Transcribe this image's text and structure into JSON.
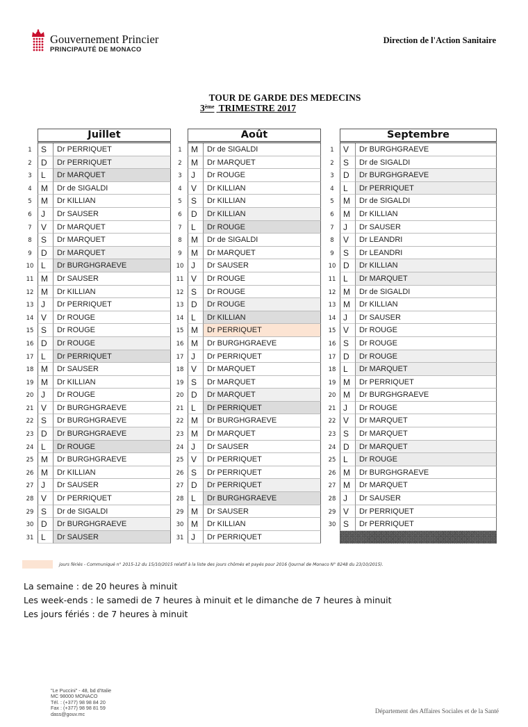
{
  "header": {
    "logo_title": "Gouvernement Princier",
    "logo_subtitle": "PRINCIPAUTÉ DE MONACO",
    "department": "Direction de l'Action Sanitaire",
    "brand_color": "#c8102e"
  },
  "title": {
    "line1": "TOUR DE GARDE DES MEDECINS",
    "line2_ordinal": "3",
    "line2_suffix": "ème",
    "line2_rest": "TRIMESTRE 2017"
  },
  "months": [
    {
      "name": "Juillet",
      "days": [
        {
          "n": "1",
          "dow": "S",
          "doctor": "Dr PERRIQUET",
          "shade": ""
        },
        {
          "n": "2",
          "dow": "D",
          "doctor": "Dr PERRIQUET",
          "shade": "sun"
        },
        {
          "n": "3",
          "dow": "L",
          "doctor": "Dr MARQUET",
          "shade": "mon"
        },
        {
          "n": "4",
          "dow": "M",
          "doctor": "Dr de SIGALDI",
          "shade": ""
        },
        {
          "n": "5",
          "dow": "M",
          "doctor": "Dr KILLIAN",
          "shade": ""
        },
        {
          "n": "6",
          "dow": "J",
          "doctor": "Dr SAUSER",
          "shade": ""
        },
        {
          "n": "7",
          "dow": "V",
          "doctor": "Dr MARQUET",
          "shade": ""
        },
        {
          "n": "8",
          "dow": "S",
          "doctor": "Dr MARQUET",
          "shade": ""
        },
        {
          "n": "9",
          "dow": "D",
          "doctor": "Dr MARQUET",
          "shade": "sun"
        },
        {
          "n": "10",
          "dow": "L",
          "doctor": "Dr BURGHGRAEVE",
          "shade": "mon"
        },
        {
          "n": "11",
          "dow": "M",
          "doctor": "Dr  SAUSER",
          "shade": ""
        },
        {
          "n": "12",
          "dow": "M",
          "doctor": "Dr KILLIAN",
          "shade": ""
        },
        {
          "n": "13",
          "dow": "J",
          "doctor": "Dr PERRIQUET",
          "shade": ""
        },
        {
          "n": "14",
          "dow": "V",
          "doctor": "Dr ROUGE",
          "shade": ""
        },
        {
          "n": "15",
          "dow": "S",
          "doctor": "Dr ROUGE",
          "shade": ""
        },
        {
          "n": "16",
          "dow": "D",
          "doctor": "Dr ROUGE",
          "shade": "sun"
        },
        {
          "n": "17",
          "dow": "L",
          "doctor": "Dr PERRIQUET",
          "shade": "mon"
        },
        {
          "n": "18",
          "dow": "M",
          "doctor": "Dr SAUSER",
          "shade": ""
        },
        {
          "n": "19",
          "dow": "M",
          "doctor": "Dr KILLIAN",
          "shade": ""
        },
        {
          "n": "20",
          "dow": "J",
          "doctor": "Dr ROUGE",
          "shade": ""
        },
        {
          "n": "21",
          "dow": "V",
          "doctor": "Dr BURGHGRAEVE",
          "shade": ""
        },
        {
          "n": "22",
          "dow": "S",
          "doctor": "Dr BURGHGRAEVE",
          "shade": ""
        },
        {
          "n": "23",
          "dow": "D",
          "doctor": "Dr BURGHGRAEVE",
          "shade": "sun"
        },
        {
          "n": "24",
          "dow": "L",
          "doctor": "Dr ROUGE",
          "shade": "mon"
        },
        {
          "n": "25",
          "dow": "M",
          "doctor": "Dr BURGHGRAEVE",
          "shade": ""
        },
        {
          "n": "26",
          "dow": "M",
          "doctor": "Dr KILLIAN",
          "shade": ""
        },
        {
          "n": "27",
          "dow": "J",
          "doctor": "Dr SAUSER",
          "shade": ""
        },
        {
          "n": "28",
          "dow": "V",
          "doctor": "Dr PERRIQUET",
          "shade": ""
        },
        {
          "n": "29",
          "dow": "S",
          "doctor": "Dr de SIGALDI",
          "shade": ""
        },
        {
          "n": "30",
          "dow": "D",
          "doctor": "Dr BURGHGRAEVE",
          "shade": "sun"
        },
        {
          "n": "31",
          "dow": "L",
          "doctor": "Dr SAUSER",
          "shade": "mon"
        }
      ]
    },
    {
      "name": "Août",
      "days": [
        {
          "n": "1",
          "dow": "M",
          "doctor": "Dr de SIGALDI",
          "shade": ""
        },
        {
          "n": "2",
          "dow": "M",
          "doctor": "Dr MARQUET",
          "shade": ""
        },
        {
          "n": "3",
          "dow": "J",
          "doctor": "Dr ROUGE",
          "shade": ""
        },
        {
          "n": "4",
          "dow": "V",
          "doctor": "Dr KILLIAN",
          "shade": ""
        },
        {
          "n": "5",
          "dow": "S",
          "doctor": "Dr KILLIAN",
          "shade": ""
        },
        {
          "n": "6",
          "dow": "D",
          "doctor": "Dr KILLIAN",
          "shade": "sun"
        },
        {
          "n": "7",
          "dow": "L",
          "doctor": "Dr ROUGE",
          "shade": "mon"
        },
        {
          "n": "8",
          "dow": "M",
          "doctor": "Dr de SIGALDI",
          "shade": ""
        },
        {
          "n": "9",
          "dow": "M",
          "doctor": "Dr MARQUET",
          "shade": ""
        },
        {
          "n": "10",
          "dow": "J",
          "doctor": "Dr SAUSER",
          "shade": ""
        },
        {
          "n": "11",
          "dow": "V",
          "doctor": "Dr ROUGE",
          "shade": ""
        },
        {
          "n": "12",
          "dow": "S",
          "doctor": "Dr ROUGE",
          "shade": ""
        },
        {
          "n": "13",
          "dow": "D",
          "doctor": "Dr ROUGE",
          "shade": "sun"
        },
        {
          "n": "14",
          "dow": "L",
          "doctor": "Dr KILLIAN",
          "shade": "mon"
        },
        {
          "n": "15",
          "dow": "M",
          "doctor": "Dr PERRIQUET",
          "shade": "holiday"
        },
        {
          "n": "16",
          "dow": "M",
          "doctor": "Dr BURGHGRAEVE",
          "shade": ""
        },
        {
          "n": "17",
          "dow": "J",
          "doctor": "Dr PERRIQUET",
          "shade": ""
        },
        {
          "n": "18",
          "dow": "V",
          "doctor": "Dr MARQUET",
          "shade": ""
        },
        {
          "n": "19",
          "dow": "S",
          "doctor": "Dr MARQUET",
          "shade": ""
        },
        {
          "n": "20",
          "dow": "D",
          "doctor": "Dr MARQUET",
          "shade": "sun"
        },
        {
          "n": "21",
          "dow": "L",
          "doctor": "Dr PERRIQUET",
          "shade": "mon"
        },
        {
          "n": "22",
          "dow": "M",
          "doctor": "Dr BURGHGRAEVE",
          "shade": ""
        },
        {
          "n": "23",
          "dow": "M",
          "doctor": "Dr MARQUET",
          "shade": ""
        },
        {
          "n": "24",
          "dow": "J",
          "doctor": "Dr SAUSER",
          "shade": ""
        },
        {
          "n": "25",
          "dow": "V",
          "doctor": "Dr PERRIQUET",
          "shade": ""
        },
        {
          "n": "26",
          "dow": "S",
          "doctor": "Dr PERRIQUET",
          "shade": ""
        },
        {
          "n": "27",
          "dow": "D",
          "doctor": "Dr PERRIQUET",
          "shade": "sun"
        },
        {
          "n": "28",
          "dow": "L",
          "doctor": "Dr BURGHGRAEVE",
          "shade": "mon"
        },
        {
          "n": "29",
          "dow": "M",
          "doctor": "Dr SAUSER",
          "shade": ""
        },
        {
          "n": "30",
          "dow": "M",
          "doctor": "Dr KILLIAN",
          "shade": ""
        },
        {
          "n": "31",
          "dow": "J",
          "doctor": " Dr PERRIQUET",
          "shade": ""
        }
      ]
    },
    {
      "name": "Septembre",
      "days": [
        {
          "n": "1",
          "dow": "V",
          "doctor": "Dr BURGHGRAEVE",
          "shade": ""
        },
        {
          "n": "2",
          "dow": "S",
          "doctor": "Dr de SIGALDI",
          "shade": ""
        },
        {
          "n": "3",
          "dow": "D",
          "doctor": "Dr BURGHGRAEVE",
          "shade": "sun"
        },
        {
          "n": "4",
          "dow": "L",
          "doctor": "Dr PERRIQUET",
          "shade": "mon-light"
        },
        {
          "n": "5",
          "dow": "M",
          "doctor": "Dr de SIGALDI",
          "shade": ""
        },
        {
          "n": "6",
          "dow": "M",
          "doctor": "Dr KILLIAN",
          "shade": ""
        },
        {
          "n": "7",
          "dow": "J",
          "doctor": "Dr SAUSER",
          "shade": ""
        },
        {
          "n": "8",
          "dow": "V",
          "doctor": "Dr LEANDRI",
          "shade": ""
        },
        {
          "n": "9",
          "dow": "S",
          "doctor": "Dr LEANDRI",
          "shade": ""
        },
        {
          "n": "10",
          "dow": "D",
          "doctor": "Dr KILLIAN",
          "shade": "sun"
        },
        {
          "n": "11",
          "dow": "L",
          "doctor": "Dr MARQUET",
          "shade": "mon-light"
        },
        {
          "n": "12",
          "dow": "M",
          "doctor": "Dr de SIGALDI",
          "shade": ""
        },
        {
          "n": "13",
          "dow": "M",
          "doctor": "Dr KILLIAN",
          "shade": ""
        },
        {
          "n": "14",
          "dow": "J",
          "doctor": "Dr SAUSER",
          "shade": ""
        },
        {
          "n": "15",
          "dow": "V",
          "doctor": "Dr ROUGE",
          "shade": ""
        },
        {
          "n": "16",
          "dow": "S",
          "doctor": "Dr ROUGE",
          "shade": ""
        },
        {
          "n": "17",
          "dow": "D",
          "doctor": "Dr ROUGE",
          "shade": "sun"
        },
        {
          "n": "18",
          "dow": "L",
          "doctor": "Dr MARQUET",
          "shade": "mon-light"
        },
        {
          "n": "19",
          "dow": "M",
          "doctor": "Dr PERRIQUET",
          "shade": ""
        },
        {
          "n": "20",
          "dow": "M",
          "doctor": "Dr BURGHGRAEVE",
          "shade": ""
        },
        {
          "n": "21",
          "dow": "J",
          "doctor": "Dr ROUGE",
          "shade": ""
        },
        {
          "n": "22",
          "dow": "V",
          "doctor": "Dr MARQUET",
          "shade": ""
        },
        {
          "n": "23",
          "dow": "S",
          "doctor": "Dr MARQUET",
          "shade": ""
        },
        {
          "n": "24",
          "dow": "D",
          "doctor": "Dr MARQUET",
          "shade": "sun"
        },
        {
          "n": "25",
          "dow": "L",
          "doctor": "Dr ROUGE",
          "shade": "mon-light"
        },
        {
          "n": "26",
          "dow": "M",
          "doctor": "Dr BURGHGRAEVE",
          "shade": ""
        },
        {
          "n": "27",
          "dow": "M",
          "doctor": "Dr MARQUET",
          "shade": ""
        },
        {
          "n": "28",
          "dow": "J",
          "doctor": "Dr SAUSER",
          "shade": ""
        },
        {
          "n": "29",
          "dow": "V",
          "doctor": "Dr PERRIQUET",
          "shade": ""
        },
        {
          "n": "30",
          "dow": "S",
          "doctor": "Dr PERRIQUET",
          "shade": ""
        }
      ],
      "blocked_last_row": true
    }
  ],
  "legend": {
    "holiday_color": "#fce4d3",
    "text": "jours fériés - Communiqué n° 2015-12 du 15/10/2015 relatif à la liste des jours chômés et payés pour 2016 (Journal de Monaco N° 8248 du 23/10/2015)."
  },
  "hours": [
    "La semaine : de 20 heures à minuit",
    "Les week-ends : le samedi de 7 heures à minuit et le dimanche de 7 heures à minuit",
    "Les jours fériés : de 7 heures à minuit"
  ],
  "footer": {
    "address": [
      "\"Le Puccini\" - 48, bd d'Italie",
      "MC 98000 MONACO",
      "Tél. : (+377) 98 98 84 20",
      "Fax : (+377) 98 98 81 59",
      "dass@gouv.mc"
    ],
    "department": "Département des Affaires Sociales et de la Santé"
  }
}
